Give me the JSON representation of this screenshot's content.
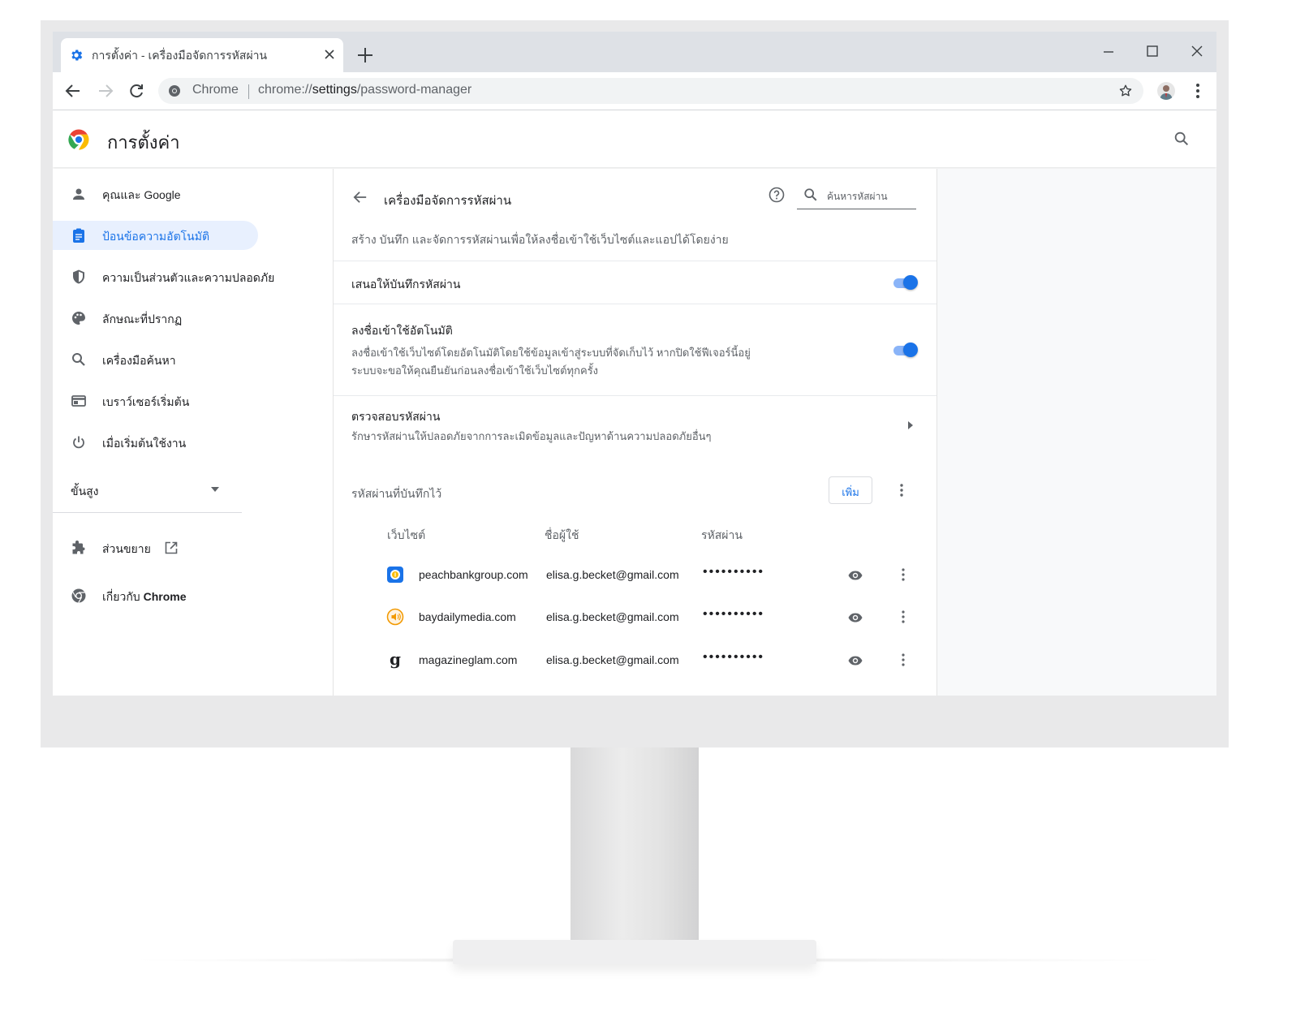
{
  "browser": {
    "tab_title": "การตั้งค่า - เครื่องมือจัดการรหัสผ่าน",
    "omnibox": {
      "site_label": "Chrome",
      "url_scheme": "chrome://",
      "url_host": "settings",
      "url_path": "/password-manager"
    }
  },
  "settings": {
    "title": "การตั้งค่า",
    "sidebar": {
      "items": [
        {
          "label": "คุณและ ",
          "label_bold": "Google",
          "icon": "person-icon"
        },
        {
          "label": "ป้อนข้อความอัตโนมัติ",
          "icon": "clipboard-icon",
          "active": true
        },
        {
          "label": "ความเป็นส่วนตัวและความปลอดภัย",
          "icon": "shield-icon"
        },
        {
          "label": "ลักษณะที่ปรากฏ",
          "icon": "palette-icon"
        },
        {
          "label": "เครื่องมือค้นหา",
          "icon": "search-icon"
        },
        {
          "label": "เบราว์เซอร์เริ่มต้น",
          "icon": "browser-window-icon"
        },
        {
          "label": "เมื่อเริ่มต้นใช้งาน",
          "icon": "power-icon"
        }
      ],
      "advanced_label": "ขั้นสูง",
      "extensions_label": "ส่วนขยาย",
      "about_label": "เกี่ยวกับ ",
      "about_label_bold": "Chrome"
    },
    "password_manager": {
      "title": "เครื่องมือจัดการรหัสผ่าน",
      "search_placeholder": "ค้นหารหัสผ่าน",
      "description": "สร้าง บันทึก และจัดการรหัสผ่านเพื่อให้ลงชื่อเข้าใช้เว็บไซต์และแอปได้โดยง่าย",
      "offer_to_save": {
        "label": "เสนอให้บันทึกรหัสผ่าน",
        "enabled": true
      },
      "auto_signin": {
        "label": "ลงชื่อเข้าใช้อัตโนมัติ",
        "desc_line1": "ลงชื่อเข้าใช้เว็บไซต์โดยอัตโนมัติโดยใช้ข้อมูลเข้าสู่ระบบที่จัดเก็บไว้ หากปิดใช้ฟีเจอร์นี้อยู่",
        "desc_line2": "ระบบจะขอให้คุณยืนยันก่อนลงชื่อเข้าใช้เว็บไซต์ทุกครั้ง",
        "enabled": true
      },
      "check_passwords": {
        "label": "ตรวจสอบรหัสผ่าน",
        "desc": "รักษารหัสผ่านให้ปลอดภัยจากการละเมิดข้อมูลและปัญหาด้านความปลอดภัยอื่นๆ"
      },
      "saved_passwords": {
        "heading": "รหัสผ่านที่บันทึกไว้",
        "add_button": "เพิ่ม",
        "columns": [
          "เว็บไซต์",
          "ชื่อผู้ใช้",
          "รหัสผ่าน"
        ],
        "rows": [
          {
            "site": "peachbankgroup.com",
            "username": "elisa.g.becket@gmail.com",
            "password": "••••••••••",
            "favicon": "bank-favicon"
          },
          {
            "site": "baydailymedia.com",
            "username": "elisa.g.becket@gmail.com",
            "password": "••••••••••",
            "favicon": "speaker-favicon"
          },
          {
            "site": "magazineglam.com",
            "username": "elisa.g.becket@gmail.com",
            "password": "••••••••••",
            "favicon": "glam-g-favicon",
            "favicon_letter": "g"
          }
        ]
      }
    }
  },
  "colors": {
    "accent": "#1a73e8",
    "active_nav_bg": "#e8f0fe",
    "toggle_track": "#8ab4f8",
    "tabstrip": "#dee1e6"
  }
}
